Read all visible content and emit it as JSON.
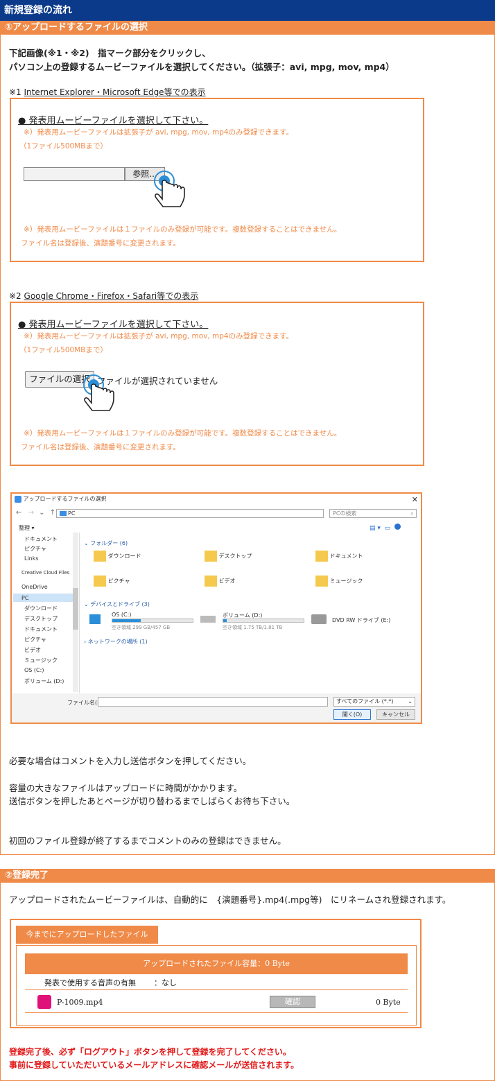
{
  "page_title": "新規登録の流れ",
  "section1": {
    "header": "①アップロードするファイルの選択",
    "intro_line1": "下記画像(※1・※2)　指マーク部分をクリックし、",
    "intro_line2": "パソコン上の登録するムービーファイルを選択してください。（拡張子：avi, mpg, mov, mp4）",
    "note1_prefix": "※1 ",
    "note1_label": "Internet Explorer・Microsoft Edge等での表示",
    "note2_prefix": "※2 ",
    "note2_label": "Google Chrome・Firefox・Safari等での表示",
    "select_title": "● 発表用ムービーファイルを選択して下さい。",
    "ext_note": "※）発表用ムービーファイルは拡張子が avi, mpg, mov, mp4のみ登録できます。",
    "size_note": "（1ファイル500MBまで）",
    "browse_button": "参照...",
    "choose_file_button": "ファイルの選択",
    "no_file_text": "ファイルが選択されていません",
    "one_file_note": "※）発表用ムービーファイルは１ファイルのみ登録が可能です。複数登録することはできません。",
    "rename_note": "ファイル名は登録後、演題番号に変更されます。",
    "dialog": {
      "title": "アップロードするファイルの選択",
      "address": "PC",
      "search_placeholder": "PCの検索",
      "organize": "整理 ▾",
      "folders_header": "フォルダー (6)",
      "folders": [
        "ダウンロード",
        "デスクトップ",
        "ドキュメント",
        "ピクチャ",
        "ビデオ",
        "ミュージック"
      ],
      "drives_header": "デバイスとドライブ (3)",
      "drives": [
        {
          "name": "OS (C:)",
          "space": "空き領域 299 GB/457 GB",
          "used": 0.35
        },
        {
          "name": "ボリューム (D:)",
          "space": "空き領域 1.75 TB/1.81 TB",
          "used": 0.04
        },
        {
          "name": "DVD RW ドライブ (E:)",
          "space": "",
          "used": 0
        }
      ],
      "network_header": "ネットワークの場所 (1)",
      "nav": [
        "ドキュメント",
        "ピクチャ",
        "Links",
        "Creative Cloud Files",
        "OneDrive",
        "PC",
        "ダウンロード",
        "デスクトップ",
        "ドキュメント",
        "ピクチャ",
        "ビデオ",
        "ミュージック",
        "OS (C:)",
        "ボリューム (D:)"
      ],
      "filename_label": "ファイル名(N):",
      "filetype": "すべてのファイル (*.*)",
      "open_button": "開く(O)",
      "cancel_button": "キャンセル"
    },
    "comment_note": "必要な場合はコメントを入力し送信ボタンを押してください。",
    "large_note1": "容量の大きなファイルはアップロードに時間がかかります。",
    "large_note2": "送信ボタンを押したあとページが切り替わるまでしばらくお待ち下さい。",
    "first_note": "初回のファイル登録が終了するまでコメントのみの登録はできません。"
  },
  "section2": {
    "header": "②登録完了",
    "rename_text": "アップロードされたムービーファイルは、自動的に　{演題番号}.mp4(.mpg等)　にリネームされ登録されます。",
    "tab_label": "今までにアップロードしたファイル",
    "capacity_label": "アップロードされたファイル容量：0 Byte",
    "audio_label": "発表で使用する音声の有無",
    "audio_value": "：なし",
    "file_name": "P-1009.mp4",
    "confirm_button": "確認",
    "file_size": "0 Byte",
    "warning1": "登録完了後、必ず「ログアウト」ボタンを押して登録を完了してください。",
    "warning2": "事前に登録していただいているメールアドレスに確認メールが送信されます。"
  }
}
